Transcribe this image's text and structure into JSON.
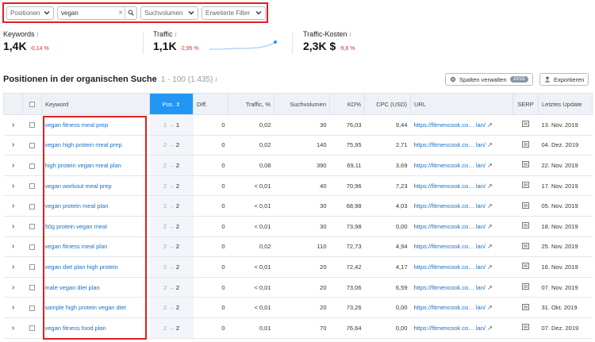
{
  "filters": {
    "positions_label": "Positionen",
    "search_value": "vegan",
    "volume_label": "Suchvolumen",
    "advanced_label": "Erweiterte Filter"
  },
  "kpis": [
    {
      "label": "Keywords",
      "value": "1,4K",
      "change": "-0,14 %"
    },
    {
      "label": "Traffic",
      "value": "1,1K",
      "change": "-2,95 %"
    },
    {
      "label": "Traffic-Kosten",
      "value": "2,3K $",
      "change": "-9,8 %"
    }
  ],
  "section": {
    "title": "Positionen in der organischen Suche",
    "range": "1 - 100 (1.435)",
    "manage_columns_label": "Spalten verwalten",
    "columns_badge": "10/15",
    "export_label": "Exportieren"
  },
  "table": {
    "headers": {
      "keyword": "Keyword",
      "pos": "Pos.",
      "diff": "Diff.",
      "traffic": "Traffic, %",
      "volume": "Suchvolumen",
      "kd": "KD%",
      "cpc": "CPC (USD)",
      "url": "URL",
      "serp": "SERP",
      "updated": "Letztes Update"
    },
    "rows": [
      {
        "keyword": "vegan fitness meal prep",
        "prev": "1",
        "pos": "1",
        "diff": "0",
        "traffic": "0,02",
        "volume": "30",
        "kd": "76,03",
        "cpc": "9,44",
        "url": "https://fitmencook.co…",
        "url_tail": "lan/",
        "updated": "13. Nov. 2019"
      },
      {
        "keyword": "vegan high protein meal prep",
        "prev": "2",
        "pos": "2",
        "diff": "0",
        "traffic": "0,02",
        "volume": "140",
        "kd": "75,95",
        "cpc": "2,71",
        "url": "https://fitmencook.co…",
        "url_tail": "lan/",
        "updated": "04. Dez. 2019"
      },
      {
        "keyword": "high protein vegan meal plan",
        "prev": "2",
        "pos": "2",
        "diff": "0",
        "traffic": "0,08",
        "volume": "390",
        "kd": "69,11",
        "cpc": "3,69",
        "url": "https://fitmencook.co…",
        "url_tail": "lan/",
        "updated": "22. Nov. 2019"
      },
      {
        "keyword": "vegan workout meal prep",
        "prev": "2",
        "pos": "2",
        "diff": "0",
        "traffic": "< 0,01",
        "volume": "40",
        "kd": "70,96",
        "cpc": "7,23",
        "url": "https://fitmencook.co…",
        "url_tail": "lan/",
        "updated": "17. Nov. 2019"
      },
      {
        "keyword": "vegan protein meal plan",
        "prev": "2",
        "pos": "2",
        "diff": "0",
        "traffic": "< 0,01",
        "volume": "30",
        "kd": "68,98",
        "cpc": "4,03",
        "url": "https://fitmencook.co…",
        "url_tail": "lan/",
        "updated": "05. Nov. 2019"
      },
      {
        "keyword": "50g protein vegan meal",
        "prev": "2",
        "pos": "2",
        "diff": "0",
        "traffic": "< 0,01",
        "volume": "30",
        "kd": "73,98",
        "cpc": "0,00",
        "url": "https://fitmencook.co…",
        "url_tail": "lan/",
        "updated": "18. Nov. 2019"
      },
      {
        "keyword": "vegan fitness meal plan",
        "prev": "2",
        "pos": "2",
        "diff": "0",
        "traffic": "0,02",
        "volume": "110",
        "kd": "72,73",
        "cpc": "4,94",
        "url": "https://fitmencook.co…",
        "url_tail": "lan/",
        "updated": "25. Nov. 2019"
      },
      {
        "keyword": "vegan diet plan high protein",
        "prev": "2",
        "pos": "2",
        "diff": "0",
        "traffic": "< 0,01",
        "volume": "20",
        "kd": "72,42",
        "cpc": "4,17",
        "url": "https://fitmencook.co…",
        "url_tail": "lan/",
        "updated": "16. Nov. 2019"
      },
      {
        "keyword": "male vegan diet plan",
        "prev": "2",
        "pos": "2",
        "diff": "0",
        "traffic": "< 0,01",
        "volume": "20",
        "kd": "73,06",
        "cpc": "6,59",
        "url": "https://fitmencook.co…",
        "url_tail": "lan/",
        "updated": "07. Nov. 2019"
      },
      {
        "keyword": "sample high protein vegan diet",
        "prev": "2",
        "pos": "2",
        "diff": "0",
        "traffic": "< 0,01",
        "volume": "20",
        "kd": "73,26",
        "cpc": "0,00",
        "url": "https://fitmencook.co…",
        "url_tail": "lan/",
        "updated": "31. Okt. 2019"
      },
      {
        "keyword": "vegan fitness food plan",
        "prev": "2",
        "pos": "2",
        "diff": "0",
        "traffic": "0,01",
        "volume": "70",
        "kd": "76,64",
        "cpc": "0,00",
        "url": "https://fitmencook.co…",
        "url_tail": "lan/",
        "updated": "07. Dez. 2019"
      }
    ]
  },
  "colors": {
    "accent": "#2196f3",
    "link": "#1a6fc4",
    "negative": "#d32f2f",
    "highlight": "#e02020"
  }
}
